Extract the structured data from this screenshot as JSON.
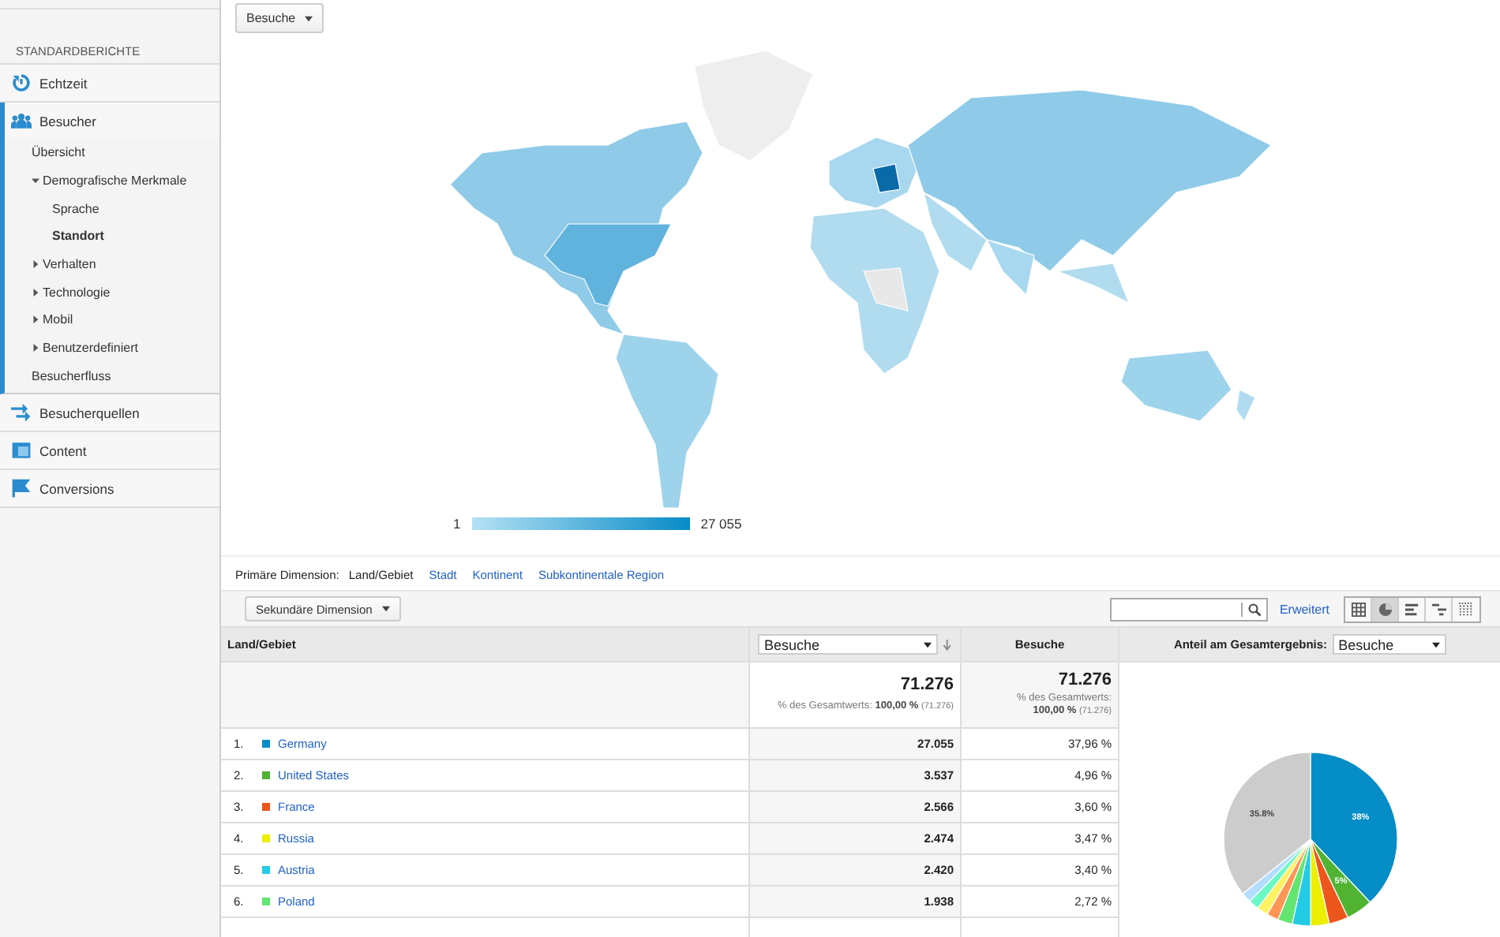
{
  "sidebar": {
    "heading": "STANDARDBERICHTE",
    "sections": [
      {
        "label": "Echtzeit",
        "expanded": false
      },
      {
        "label": "Besucher",
        "expanded": true,
        "children": [
          {
            "label": "Übersicht",
            "kind": "link",
            "selected": false
          },
          {
            "label": "Demografische Merkmale",
            "kind": "group",
            "expanded": true,
            "selected": false,
            "children": [
              {
                "label": "Sprache",
                "kind": "link",
                "selected": false
              },
              {
                "label": "Standort",
                "kind": "link",
                "selected": true
              }
            ]
          },
          {
            "label": "Verhalten",
            "kind": "group",
            "expanded": false,
            "selected": false
          },
          {
            "label": "Technologie",
            "kind": "group",
            "expanded": false,
            "selected": false
          },
          {
            "label": "Mobil",
            "kind": "group",
            "expanded": false,
            "selected": false
          },
          {
            "label": "Benutzerdefiniert",
            "kind": "group",
            "expanded": false,
            "selected": false
          },
          {
            "label": "Besucherfluss",
            "kind": "link",
            "selected": false
          }
        ]
      },
      {
        "label": "Besucherquellen",
        "expanded": false
      },
      {
        "label": "Content",
        "expanded": false
      },
      {
        "label": "Conversions",
        "expanded": false
      }
    ]
  },
  "metric_dropdown": "Besuche",
  "map": {
    "legend_min": "1",
    "legend_max": "27 055"
  },
  "primary_dimension": {
    "label": "Primäre Dimension:",
    "options": [
      {
        "label": "Land/Gebiet",
        "selected": true
      },
      {
        "label": "Stadt",
        "selected": false
      },
      {
        "label": "Kontinent",
        "selected": false
      },
      {
        "label": "Subkontinentale Region",
        "selected": false
      }
    ]
  },
  "toolbar": {
    "secondary_dimension": "Sekundäre Dimension",
    "advanced_link": "Erweitert",
    "views": [
      {
        "kind": "table",
        "selected": false
      },
      {
        "kind": "pie",
        "selected": true
      },
      {
        "kind": "bars",
        "selected": false
      },
      {
        "kind": "compare",
        "selected": false
      },
      {
        "kind": "pivot",
        "selected": false
      }
    ]
  },
  "table": {
    "columns": {
      "dimension": "Land/Gebiet",
      "metric_select": "Besuche",
      "metric": "Besuche",
      "share_label": "Anteil am Gesamtergebnis:",
      "share_select": "Besuche"
    },
    "totals": {
      "value": "71.276",
      "note_label": "% des Gesamtwerts:",
      "note_value": "100,00 %",
      "note_total": "(71.276)",
      "share_value": "71.276",
      "share_note_label": "% des Gesamtwerts:",
      "share_note_value": "100,00 %",
      "share_note_total": "(71.276)"
    },
    "rows": [
      {
        "rank": "1.",
        "country": "Germany",
        "color": "#058dc7",
        "visits": "27.055",
        "share": "37,96 %"
      },
      {
        "rank": "2.",
        "country": "United States",
        "color": "#50b432",
        "visits": "3.537",
        "share": "4,96 %"
      },
      {
        "rank": "3.",
        "country": "France",
        "color": "#ed561b",
        "visits": "2.566",
        "share": "3,60 %"
      },
      {
        "rank": "4.",
        "country": "Russia",
        "color": "#edef00",
        "visits": "2.474",
        "share": "3,47 %"
      },
      {
        "rank": "5.",
        "country": "Austria",
        "color": "#24cbe5",
        "visits": "2.420",
        "share": "3,40 %"
      },
      {
        "rank": "6.",
        "country": "Poland",
        "color": "#64e572",
        "visits": "1.938",
        "share": "2,72 %"
      }
    ],
    "chart_data": {
      "type": "pie",
      "values": [
        37.96,
        4.96,
        3.6,
        3.47,
        3.4,
        2.72,
        2.2,
        2.1,
        1.9,
        1.89,
        35.8
      ],
      "value_labels": [
        "38%",
        "5%",
        null,
        null,
        null,
        null,
        null,
        null,
        null,
        null,
        "35.8%"
      ]
    }
  }
}
